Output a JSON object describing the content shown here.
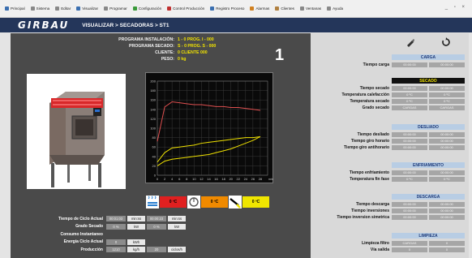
{
  "menubar": {
    "items": [
      {
        "label": "Principal",
        "icon": "home-icon",
        "color": "#3a6fb0"
      },
      {
        "label": "Sistema",
        "icon": "system-icon",
        "color": "#888888"
      },
      {
        "label": "Editar",
        "icon": "edit-icon",
        "color": "#888888"
      },
      {
        "label": "Visualizar",
        "icon": "view-icon",
        "color": "#3a6fb0"
      },
      {
        "label": "Programar",
        "icon": "program-icon",
        "color": "#888888"
      },
      {
        "label": "Configuración",
        "icon": "config-icon",
        "color": "#3a9a3a"
      },
      {
        "label": "Control Producción",
        "icon": "production-icon",
        "color": "#c03030"
      },
      {
        "label": "Registro Proceso",
        "icon": "process-log-icon",
        "color": "#3a6fb0"
      },
      {
        "label": "Alarmas",
        "icon": "alarm-icon",
        "color": "#d08020"
      },
      {
        "label": "Clientes",
        "icon": "clients-icon",
        "color": "#b08040"
      },
      {
        "label": "Ventanas",
        "icon": "windows-icon",
        "color": "#888888"
      },
      {
        "label": "Ayuda",
        "icon": "help-icon",
        "color": "#888888"
      }
    ],
    "window_controls": "_ ▫ ×"
  },
  "header": {
    "logo": "GIRBAU",
    "breadcrumb": "VISUALIZAR > SECADORAS > ST1"
  },
  "program_info": [
    {
      "label": "PROGRAMA INSTALACIÓN:",
      "value": "1 - 0   PROG. I - 000"
    },
    {
      "label": "PROGRAMA SECADO:",
      "value": "S - 0   PROG. S - 000"
    },
    {
      "label": "CLIENTE:",
      "value": "0   CLIENTE 000"
    },
    {
      "label": "PESO:",
      "value": "0   kg"
    }
  ],
  "machine_number": "1",
  "chart_data": {
    "type": "line",
    "x": [
      0,
      2,
      4,
      6,
      8,
      10,
      12,
      14,
      16,
      18,
      20,
      22,
      24,
      26,
      28
    ],
    "x_ticks": [
      "0",
      "2",
      "4",
      "6",
      "8",
      "10",
      "12",
      "14",
      "16",
      "18",
      "20",
      "22",
      "24",
      "26",
      "28"
    ],
    "x_unit": "min",
    "y_ticks": [
      "0",
      "20",
      "40",
      "60",
      "80",
      "100",
      "120",
      "140",
      "160",
      "180",
      "200"
    ],
    "ylim": [
      0,
      200
    ],
    "xlim": [
      0,
      30
    ],
    "grid": true,
    "series": [
      {
        "color": "#e05050",
        "values": [
          72,
          145,
          156,
          154,
          152,
          150,
          150,
          148,
          146,
          146,
          144,
          144,
          142,
          140,
          138
        ]
      },
      {
        "color": "#f0e200",
        "values": [
          28,
          48,
          58,
          60,
          62,
          64,
          68,
          70,
          72,
          74,
          76,
          78,
          80,
          80,
          82
        ]
      },
      {
        "color": "#f0e200",
        "values": [
          20,
          30,
          34,
          36,
          38,
          40,
          42,
          44,
          48,
          52,
          56,
          62,
          68,
          74,
          82
        ]
      }
    ]
  },
  "temp_indicators": [
    {
      "icon": "steam-heating-icon",
      "value": "0 ºC",
      "color": "#e02020"
    },
    {
      "icon": "drum-icon",
      "value": "0 ºC",
      "color": "#f08a00"
    },
    {
      "icon": "exhaust-sensor-icon",
      "value": "0 ºC",
      "color": "#f0e600"
    }
  ],
  "cycle": [
    {
      "label": "Tiempo de Ciclo Actual",
      "cells": [
        {
          "v": "00:01:03",
          "t": "val"
        },
        {
          "v": "min:ss",
          "t": "unit"
        },
        {
          "v": "00:00:23",
          "t": "val"
        },
        {
          "v": "min:ss",
          "t": "unit"
        }
      ]
    },
    {
      "label": "Grado Secado",
      "cells": [
        {
          "v": "0 %",
          "t": "val"
        },
        {
          "v": "kW",
          "t": "unit"
        },
        {
          "v": "0 %",
          "t": "val"
        },
        {
          "v": "kW",
          "t": "unit"
        }
      ]
    },
    {
      "label": "Consumo Instantaneo",
      "cells": []
    },
    {
      "label": "Energía Ciclo Actual",
      "cells": [
        {
          "v": "0",
          "t": "val"
        },
        {
          "v": "kWh",
          "t": "unit"
        }
      ]
    },
    {
      "label": "Producción",
      "cells": [
        {
          "v": "1210",
          "t": "val"
        },
        {
          "v": "kg/h",
          "t": "unit"
        },
        {
          "v": "20",
          "t": "val"
        },
        {
          "v": "ciclos/h",
          "t": "unit"
        }
      ]
    }
  ],
  "right_panel": {
    "top_icons": [
      "brush-icon",
      "refresh-icon"
    ],
    "sections": [
      {
        "title": "CARGA",
        "style": "blue",
        "rows": [
          {
            "label": "Tiempo carga",
            "values": [
              "00:00:00",
              "00:00:00"
            ]
          }
        ]
      },
      {
        "title": "SECADO",
        "style": "black",
        "rows": [
          {
            "label": "Tiempo secado",
            "values": [
              "00:00:00",
              "00:00:00"
            ]
          },
          {
            "label": "Temperatura calefacción",
            "values": [
              "0 ºC",
              "0 ºC"
            ]
          },
          {
            "label": "Temperatura secado",
            "values": [
              "0 ºC",
              "0 ºC"
            ]
          },
          {
            "label": "Grado secado",
            "values": [
              "CARGAS",
              "CARGAS"
            ]
          }
        ]
      },
      {
        "title": "DESLIADO",
        "style": "blue",
        "rows": [
          {
            "label": "Tiempo desliado",
            "values": [
              "00:00:00",
              "00:00:00"
            ]
          },
          {
            "label": "Tiempo giro horario",
            "values": [
              "00:00:00",
              "00:00:00"
            ]
          },
          {
            "label": "Tiempo giro antihorario",
            "values": [
              "00:00:00",
              "00:00:00"
            ]
          }
        ]
      },
      {
        "title": "ENFRIAMIENTO",
        "style": "blue",
        "rows": [
          {
            "label": "Tiempo enfriamiento",
            "values": [
              "00:00:00",
              "00:00:00"
            ]
          },
          {
            "label": "Temperatura fin fase",
            "values": [
              "0 ºC",
              "0 ºC"
            ]
          }
        ]
      },
      {
        "title": "DESCARGA",
        "style": "blue",
        "rows": [
          {
            "label": "Tiempo descarga",
            "values": [
              "00:00:00",
              "00:00:00"
            ]
          },
          {
            "label": "Tiempo inversiones",
            "values": [
              "00:00:00",
              "00:00:00"
            ]
          },
          {
            "label": "Tiempo inversion simetrica",
            "values": [
              "00:00:00",
              "00:00:00"
            ]
          }
        ]
      },
      {
        "title": "LIMPIEZA",
        "style": "blue",
        "rows": [
          {
            "label": "Limpieza filtro",
            "values": [
              "CARGAS",
              "0"
            ]
          },
          {
            "label": "Vía salida",
            "values": [
              "0",
              "0"
            ]
          }
        ]
      }
    ]
  }
}
